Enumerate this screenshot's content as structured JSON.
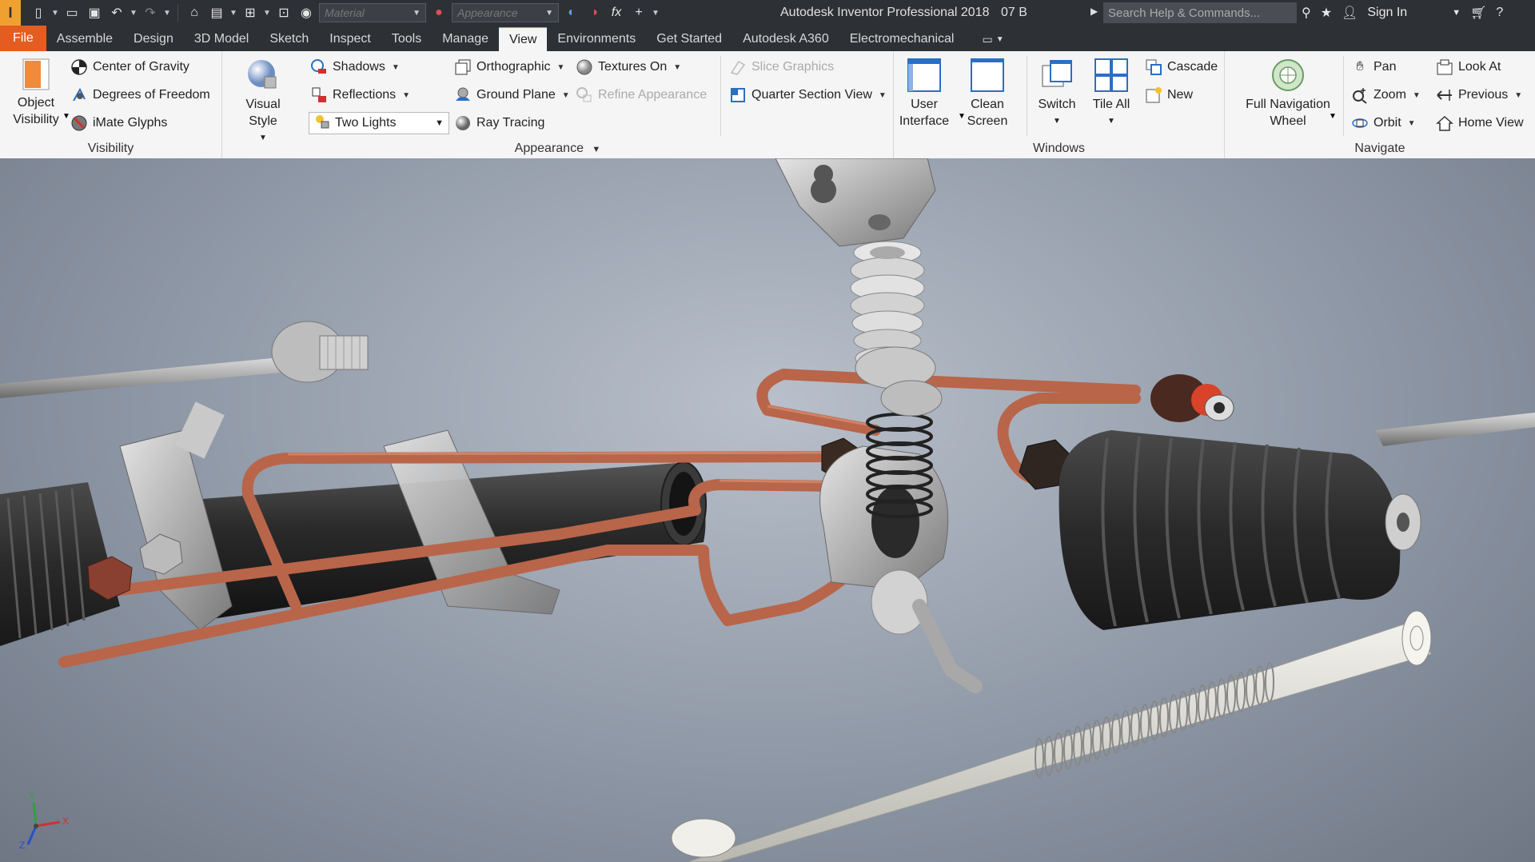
{
  "window": {
    "title": "Autodesk Inventor Professional 2018",
    "revision": "07 B",
    "search_placeholder": "Search Help & Commands...",
    "sign_in": "Sign In"
  },
  "quick_access": {
    "material_placeholder": "Material",
    "appearance_placeholder": "Appearance"
  },
  "tabs": [
    {
      "label": "File"
    },
    {
      "label": "Assemble"
    },
    {
      "label": "Design"
    },
    {
      "label": "3D Model"
    },
    {
      "label": "Sketch"
    },
    {
      "label": "Inspect"
    },
    {
      "label": "Tools"
    },
    {
      "label": "Manage"
    },
    {
      "label": "View"
    },
    {
      "label": "Environments"
    },
    {
      "label": "Get Started"
    },
    {
      "label": "Autodesk A360"
    },
    {
      "label": "Electromechanical"
    }
  ],
  "active_tab": "View",
  "ribbon": {
    "visibility": {
      "title": "Visibility",
      "object_visibility": "Object\nVisibility",
      "object_visibility_l1": "Object",
      "object_visibility_l2": "Visibility",
      "center_of_gravity": "Center of Gravity",
      "degrees_of_freedom": "Degrees of Freedom",
      "imate_glyphs": "iMate Glyphs"
    },
    "appearance": {
      "title": "Appearance",
      "visual_style": "Visual Style",
      "shadows": "Shadows",
      "reflections": "Reflections",
      "lighting": "Two Lights",
      "orthographic": "Orthographic",
      "ground_plane": "Ground Plane",
      "ray_tracing": "Ray Tracing",
      "textures_on": "Textures On",
      "refine_appearance": "Refine Appearance",
      "slice_graphics": "Slice Graphics",
      "quarter_section_view": "Quarter Section View"
    },
    "windows": {
      "title": "Windows",
      "user_interface_l1": "User",
      "user_interface_l2": "Interface",
      "clean_screen_l1": "Clean",
      "clean_screen_l2": "Screen",
      "switch": "Switch",
      "tile_all": "Tile All",
      "cascade": "Cascade",
      "new": "New"
    },
    "navigate": {
      "title": "Navigate",
      "full_nav_wheel_l1": "Full Navigation",
      "full_nav_wheel_l2": "Wheel",
      "pan": "Pan",
      "zoom": "Zoom",
      "orbit": "Orbit",
      "look_at": "Look At",
      "previous": "Previous",
      "home_view": "Home View"
    }
  },
  "viewport": {
    "axis_x": "X",
    "axis_y": "Y",
    "axis_z": "Z"
  },
  "colors": {
    "file_tab": "#e55c20",
    "dark_chrome": "#2d3035",
    "ribbon_bg": "#f5f5f5",
    "copper_pipe": "#b8654a",
    "accent_blue": "#1f6fc0"
  }
}
